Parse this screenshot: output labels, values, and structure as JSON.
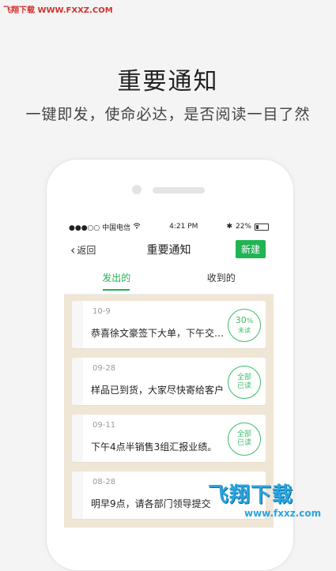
{
  "watermark_top": "飞翔下载 WWW.FXXZ.COM",
  "headline": "重要通知",
  "subline": "一键即发，使命必达，是否阅读一目了然",
  "status": {
    "carrier": "●●●○○ 中国电信",
    "time": "4:21 PM",
    "battery": "22%"
  },
  "nav": {
    "back": "返回",
    "title": "重要通知",
    "new_button": "新建"
  },
  "tabs": [
    {
      "label": "发出的"
    },
    {
      "label": "收到的"
    }
  ],
  "items": [
    {
      "date": "10-9",
      "text": "恭喜徐文豪签下大单，下午交…",
      "badge_top": "30",
      "badge_unit": "%",
      "badge_bottom": "未读"
    },
    {
      "date": "09-28",
      "text": "样品已到货，大家尽快寄给客户",
      "badge_top": "全部",
      "badge_bottom": "已读"
    },
    {
      "date": "09-11",
      "text": "下午4点半销售3组汇报业绩。",
      "badge_top": "全部",
      "badge_bottom": "已读"
    },
    {
      "date": "08-28",
      "text": "明早9点，请各部门领导提交",
      "badge_top": "",
      "badge_bottom": ""
    }
  ],
  "watermark_br": {
    "logo": "飞翔下载",
    "url": "www.fxxz.com"
  },
  "colors": {
    "accent": "#21b354",
    "list_bg": "#efe6d6"
  }
}
